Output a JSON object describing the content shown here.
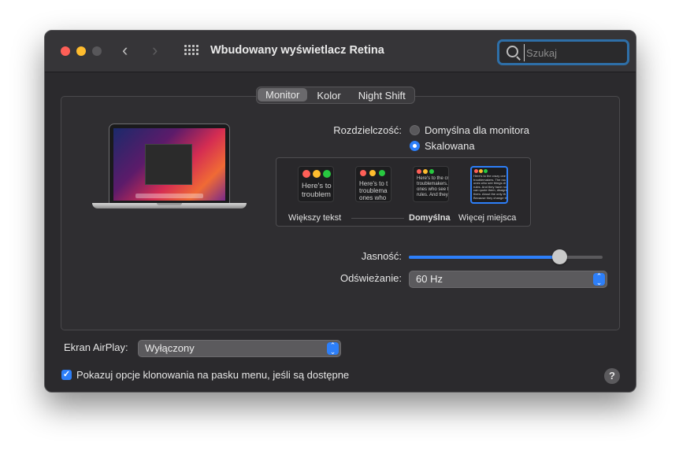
{
  "window": {
    "title": "Wbudowany wyświetlacz Retina",
    "search_placeholder": "Szukaj"
  },
  "tabs": [
    {
      "label": "Monitor",
      "active": true
    },
    {
      "label": "Kolor",
      "active": false
    },
    {
      "label": "Night Shift",
      "active": false
    }
  ],
  "resolution": {
    "label": "Rozdzielczość:",
    "options": [
      {
        "label": "Domyślna dla monitora",
        "selected": false
      },
      {
        "label": "Skalowana",
        "selected": true
      }
    ]
  },
  "scaling": {
    "thumbnails": [
      {
        "text": "Here's to\ntroublem",
        "selected": false
      },
      {
        "text": "Here's to t\ntroublema\nones who",
        "selected": false
      },
      {
        "text": "Here's to the cr\ntroublemakers.\nones who see t\nrules. And they",
        "selected": false
      },
      {
        "text": "Here's to the crazy one\ntroublemakers. The rou\nones who see things di\nrules. And they have no\ncan quote them, disagre\nthem. About the only th\nBecause they change th",
        "selected": true
      }
    ],
    "labels": {
      "larger": "Większy tekst",
      "default": "Domyślna",
      "more": "Więcej miejsca"
    }
  },
  "brightness": {
    "label": "Jasność:",
    "value": 0.78
  },
  "refresh": {
    "label": "Odświeżanie:",
    "value": "60 Hz"
  },
  "airplay": {
    "label": "Ekran AirPlay:",
    "value": "Wyłączony"
  },
  "mirror_option": {
    "label": "Pokazuj opcje klonowania na pasku menu, jeśli są dostępne",
    "checked": true
  },
  "colors": {
    "accent": "#2d7ff9",
    "window_bg": "#2b2a2d",
    "close": "#fe5f57",
    "minimize": "#febc2e"
  }
}
